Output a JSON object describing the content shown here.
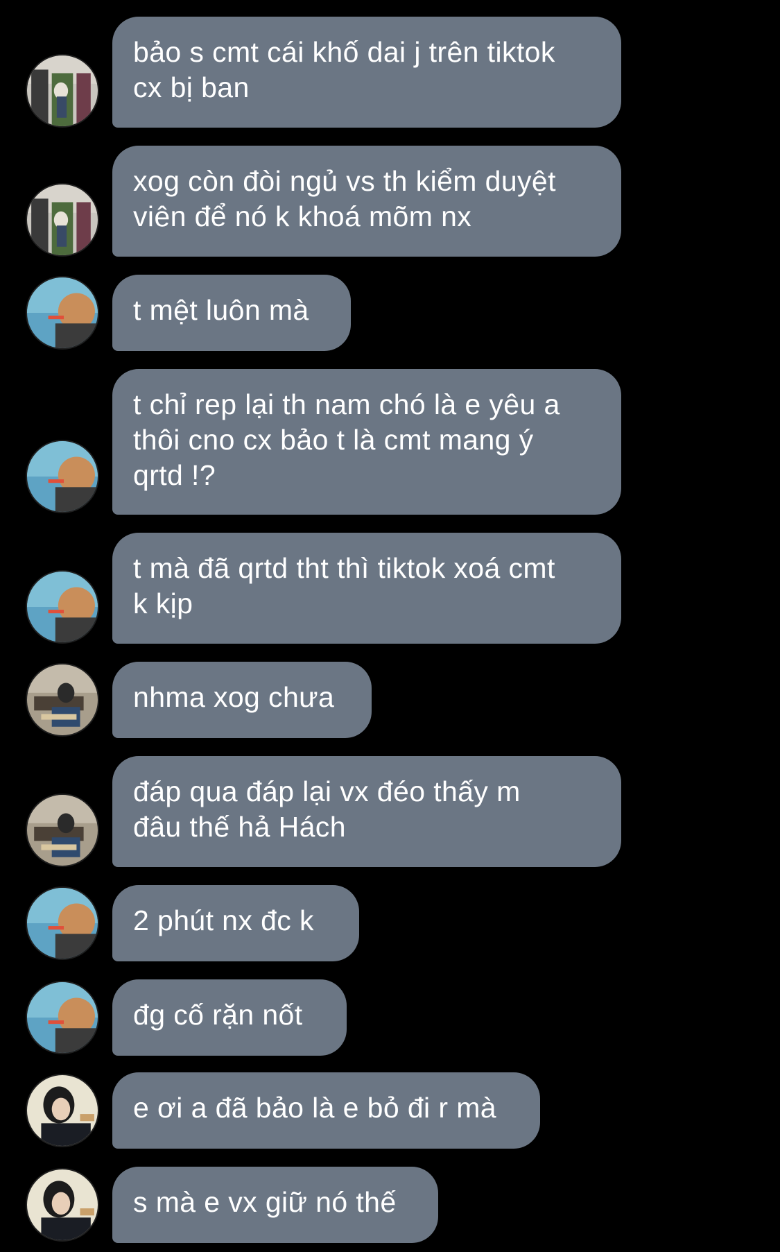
{
  "chat": {
    "background_color": "#000000",
    "bubble_color": "#6b7684",
    "text_color": "#ffffff",
    "messages": [
      {
        "text": "bảo s cmt cái khố dai j trên tiktok\ncx bị ban",
        "avatar": "avatar-house-photo"
      },
      {
        "text": "xog còn đòi ngủ vs th kiểm duyệt\nviên để nó k khoá mõm nx",
        "avatar": "avatar-house-photo"
      },
      {
        "text": "t mệt luôn mà",
        "avatar": "avatar-pool-photo"
      },
      {
        "text": "t chỉ rep lại th nam chó là e yêu a\nthôi cno cx bảo t là cmt mang ý\nqrtd !?",
        "avatar": "avatar-pool-photo"
      },
      {
        "text": "t mà đã qrtd tht thì tiktok xoá cmt\nk kịp",
        "avatar": "avatar-pool-photo"
      },
      {
        "text": "nhma xog chưa",
        "avatar": "avatar-guitar-photo"
      },
      {
        "text": "đáp qua đáp lại vx đéo thấy m\nđâu thế hả Hách",
        "avatar": "avatar-guitar-photo"
      },
      {
        "text": "2 phút nx đc k",
        "avatar": "avatar-pool-photo"
      },
      {
        "text": "đg cố rặn nốt",
        "avatar": "avatar-pool-photo"
      },
      {
        "text": "e ơi a đã bảo là e bỏ đi r mà",
        "avatar": "avatar-portrait-photo"
      },
      {
        "text": "s mà e vx giữ nó thế",
        "avatar": "avatar-portrait-photo"
      }
    ]
  }
}
